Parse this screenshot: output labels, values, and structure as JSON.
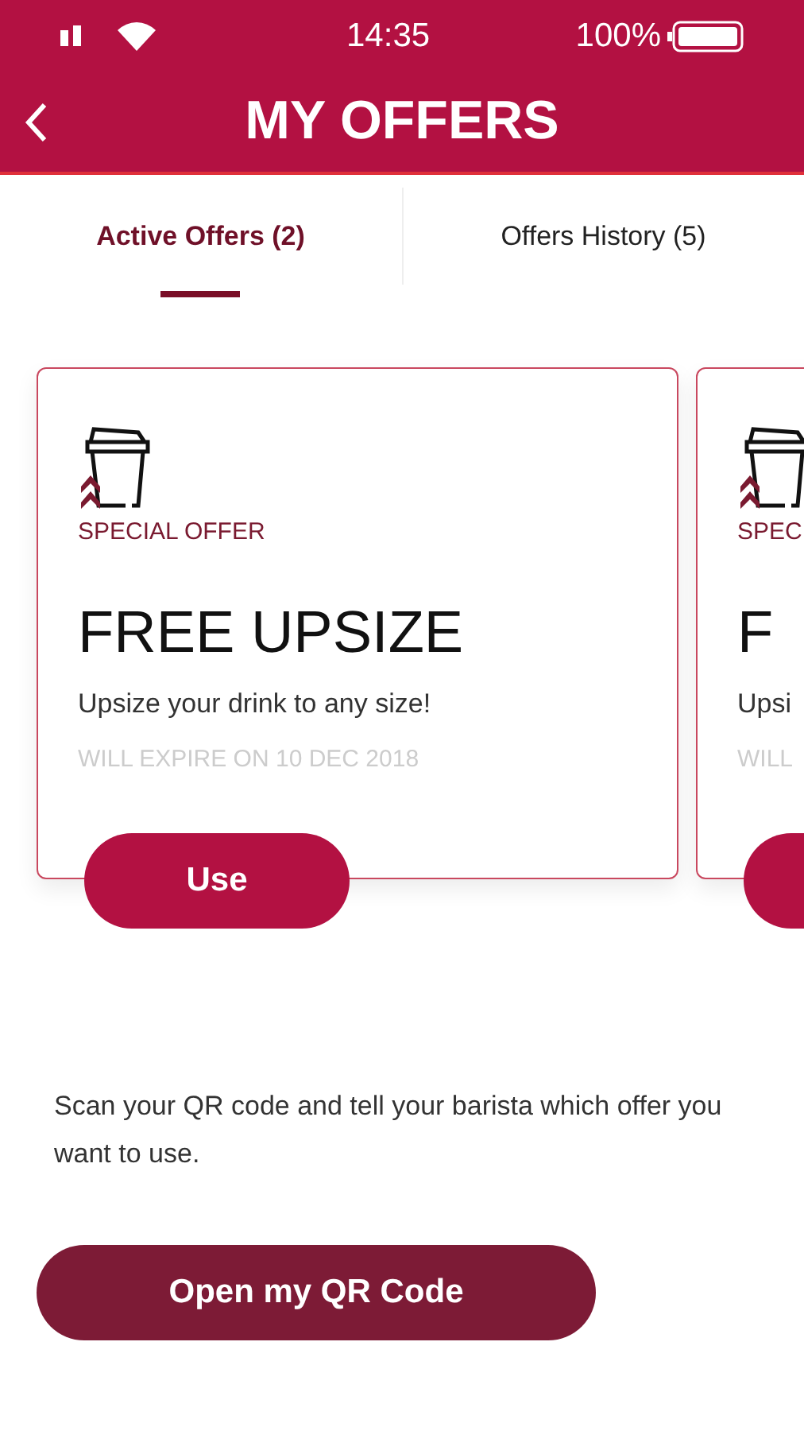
{
  "status_bar": {
    "time": "14:35",
    "battery": "100%"
  },
  "header": {
    "title": "MY OFFERS"
  },
  "tabs": [
    {
      "label": "Active Offers (2)",
      "selected": true
    },
    {
      "label": "Offers History (5)",
      "selected": false
    }
  ],
  "offers": [
    {
      "label": "SPECIAL OFFER",
      "title": "FREE UPSIZE",
      "description": "Upsize your drink to any size!",
      "expiry": "WILL EXPIRE ON 10 DEC 2018",
      "button": "Use"
    },
    {
      "label": "SPEC",
      "title": "F",
      "description": "Upsi",
      "expiry": "WILL"
    }
  ],
  "instructions": "Scan your QR code and tell your barista which offer you want to use.",
  "qr_button": "Open my QR Code"
}
